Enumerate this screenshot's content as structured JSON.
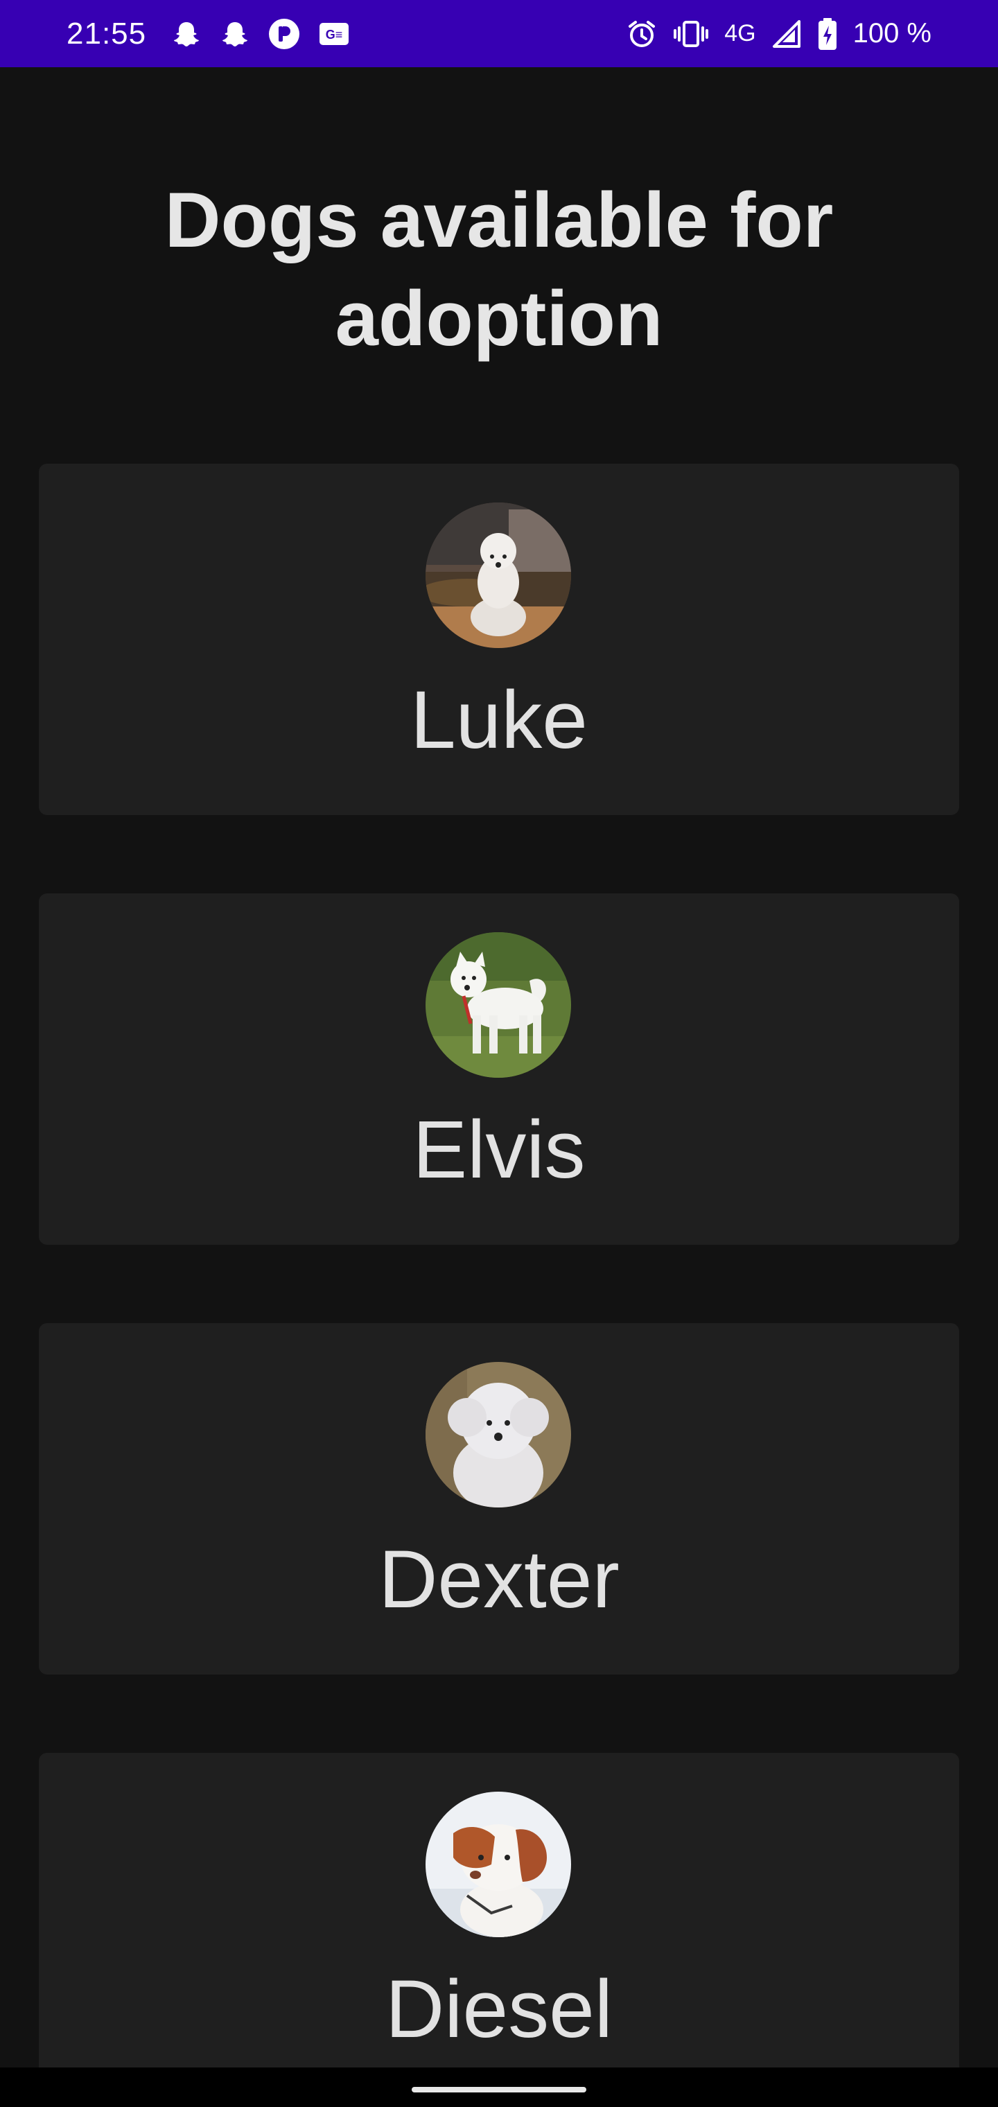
{
  "status_bar": {
    "time": "21:55",
    "network": "4G",
    "battery": "100 %",
    "left_icons": [
      "snapchat-icon",
      "snapchat-icon",
      "app-icon",
      "news-icon"
    ],
    "right_icons": [
      "alarm-icon",
      "vibrate-icon",
      "signal-icon",
      "battery-charging-icon"
    ],
    "background_color": "#3700b3"
  },
  "page": {
    "title": "Dogs available for adoption"
  },
  "dogs": [
    {
      "name": "Luke"
    },
    {
      "name": "Elvis"
    },
    {
      "name": "Dexter"
    },
    {
      "name": "Diesel"
    }
  ],
  "colors": {
    "background": "#121212",
    "card": "#1f1f1f",
    "text": "#e2e2e2"
  }
}
